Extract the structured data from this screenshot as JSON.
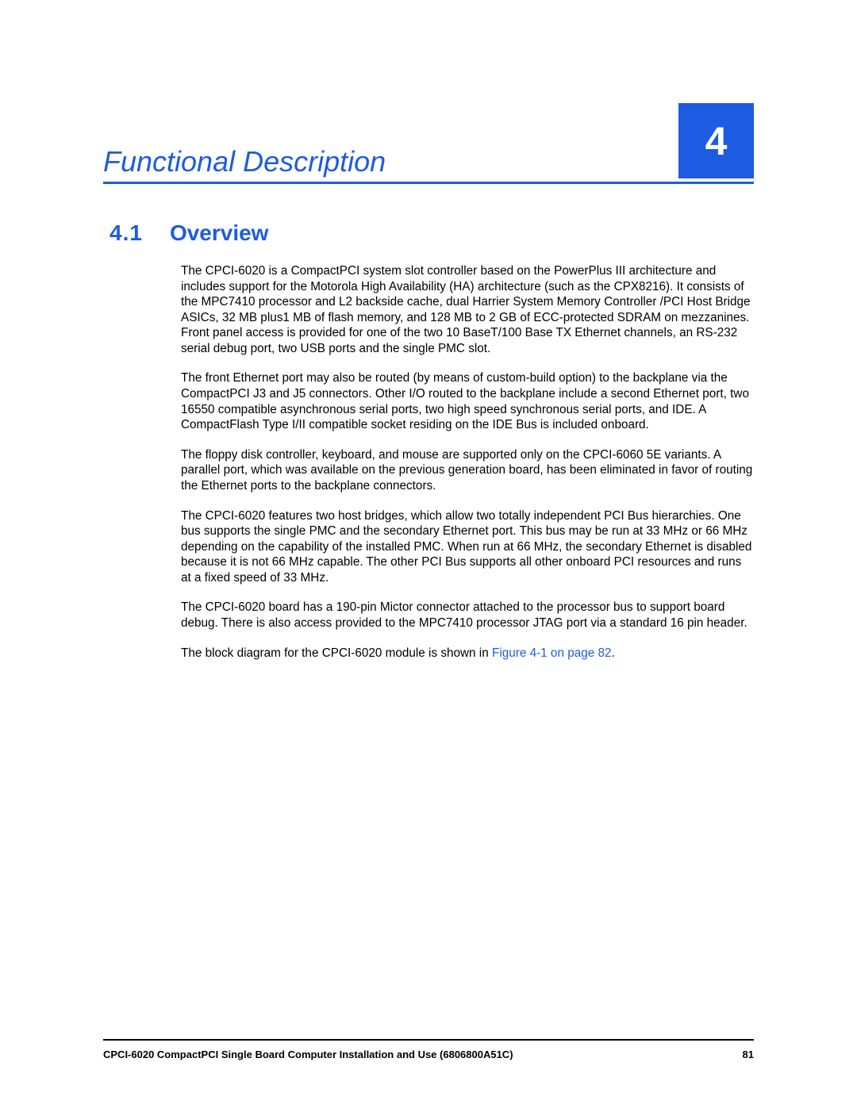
{
  "chapter": {
    "title": "Functional Description",
    "number": "4"
  },
  "section": {
    "number": "4.1",
    "title": "Overview"
  },
  "paragraphs": {
    "p1": "The CPCI-6020 is a CompactPCI system slot controller based on the PowerPlus III architecture and includes support for the Motorola High Availability (HA) architecture (such as the CPX8216). It consists of the MPC7410 processor and L2 backside cache, dual Harrier System Memory Controller /PCI Host Bridge ASICs, 32 MB plus1 MB of flash memory, and 128 MB to 2 GB of ECC-protected SDRAM on mezzanines. Front panel access is provided for one of the two 10 BaseT/100 Base TX Ethernet channels, an RS-232 serial debug port, two USB ports and the single PMC slot.",
    "p2": "The front Ethernet port may also be routed (by means of custom-build option) to the backplane via the CompactPCI J3 and J5 connectors. Other I/O routed to the backplane include a second Ethernet port, two 16550 compatible asynchronous serial ports, two high speed synchronous serial ports, and IDE. A CompactFlash Type I/II compatible socket residing on the IDE Bus is included onboard.",
    "p3": "The floppy disk controller, keyboard, and mouse are supported only on the CPCI-6060 5E variants. A parallel port, which was available on the previous generation board, has been eliminated in favor of routing the Ethernet ports to the backplane connectors.",
    "p4": "The CPCI-6020 features two host bridges, which allow two totally independent PCI Bus hierarchies. One bus supports the single PMC and the secondary Ethernet port. This bus may be run at 33 MHz or 66 MHz depending on the capability of the installed PMC. When run at 66 MHz, the secondary Ethernet is disabled because it is not 66 MHz capable. The other PCI Bus supports all other onboard PCI resources and runs at a fixed speed of 33 MHz.",
    "p5": "The CPCI-6020 board has a 190-pin Mictor connector attached to the processor bus to support board debug. There is also access provided to the MPC7410 processor JTAG port via a standard 16 pin header.",
    "p6_pre": "The block diagram for the CPCI-6020 module is shown in ",
    "p6_link": "Figure 4-1 on page 82",
    "p6_post": "."
  },
  "footer": {
    "doc_title": "CPCI-6020 CompactPCI Single Board Computer Installation and Use (6806800A51C)",
    "page_number": "81"
  }
}
